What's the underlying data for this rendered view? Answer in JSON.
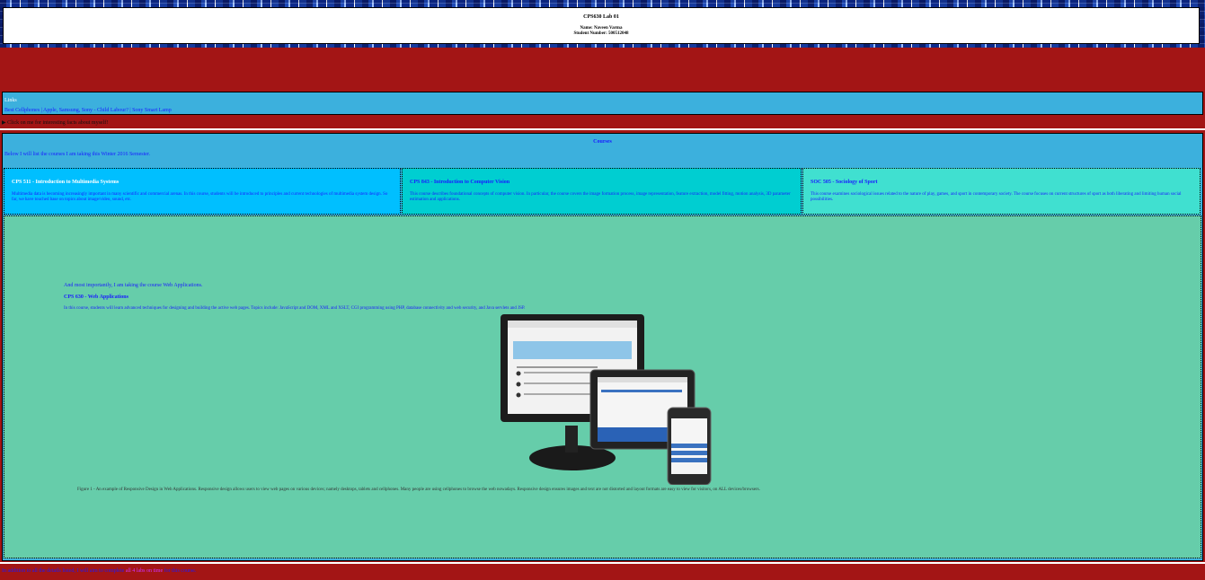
{
  "header": {
    "title": "CPS630 Lab 01",
    "name": "Name: Naveen Varma",
    "student_number": "Student Number: 500512048"
  },
  "links": {
    "title": "Links",
    "items": [
      "Best Cellphones",
      "Apple, Samsung, Sony - Child Labour?",
      "Sony Smart Lamp"
    ],
    "separators": [
      " | ",
      " | "
    ]
  },
  "details_label": "▶ Click on me for interesting facts about myself!",
  "courses": {
    "title": "Courses",
    "intro": "Below I will list the courses I am taking this Winter 2016 Semester.",
    "cards": [
      {
        "title": "CPS 511 - Introduction to Multimedia Systems",
        "description": "Multimedia data is becoming increasingly important in many scientific and commercial arenas. In this course, students will be introduced to principles and current technologies of multimedia system design. So far, we have touched base on topics about image/video, sound, etc."
      },
      {
        "title": "CPS 843 - Introduction to Computer Vision",
        "description": "This course describes foundational concepts of computer vision. In particular, the course covers the image formation process, image representation, feature extraction, model fitting, motion analysis, 3D parameter estimation and applications."
      },
      {
        "title": "SOC 505 - Sociology of Sport",
        "description": "This course examines sociological issues related to the nature of play, games, and sport in contemporary society. The course focuses on current structures of sport as both liberating and limiting human social possibilities."
      }
    ]
  },
  "web_apps": {
    "intro": "And most importantly, I am taking the course Web Applications.",
    "title": "CPS 630 - Web Applications",
    "description": "In this course, students will learn advanced techniques for designing and building the active web pages. Topics include: JavaScript and DOM, XML and XSLT, CGI programming using PHP, database connectivity and web security, and Java servlets and JSP.",
    "caption": "Figure 1 - An example of Responsive Design in Web Applications. Responsive design allows users to view web pages on various devices; namely desktops, tablets and cellphones. Many people are using cellphones to browse the web nowadays. Responsive design ensures images and text are not distorted and layout formats are easy to view for visitors, on ALL devices/browsers."
  },
  "footer": {
    "text_start": "In addition to all the details listed, I will aim to complete",
    "text_accent": " all 4 labs on time",
    "text_end": " for this course."
  },
  "colors": {
    "background": "#a31515",
    "links_box": "#3cb0dd",
    "card1": "#00bfff",
    "card2": "#00ced1",
    "card3": "#40e0d0",
    "web_section": "#66cdaa",
    "link_text": "#1a1aff"
  }
}
